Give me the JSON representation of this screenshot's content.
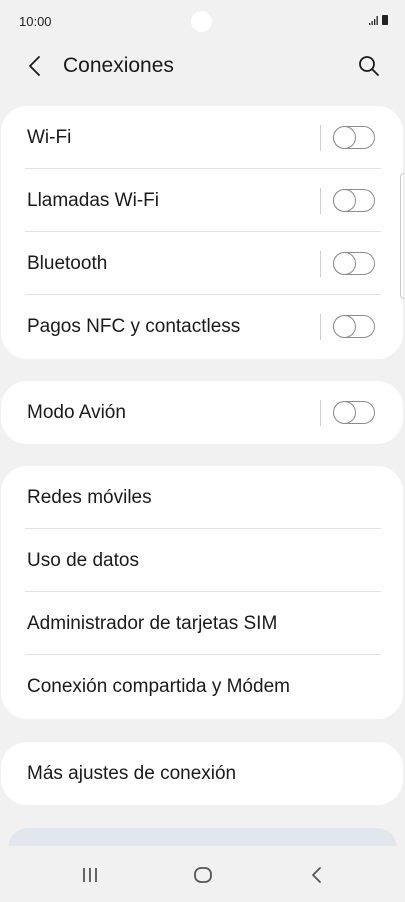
{
  "status_bar": {
    "time": "10:00",
    "icons": [
      "signal-icon",
      "battery-icon"
    ]
  },
  "header": {
    "title": "Conexiones",
    "back_icon": "chevron-left-icon",
    "search_icon": "search-icon"
  },
  "groups": {
    "wireless": [
      {
        "label": "Wi-Fi",
        "toggle": false
      },
      {
        "label": "Llamadas Wi-Fi",
        "toggle": false
      },
      {
        "label": "Bluetooth",
        "toggle": false
      },
      {
        "label": "Pagos NFC y contactless",
        "toggle": false
      }
    ],
    "airplane": [
      {
        "label": "Modo Avión",
        "toggle": false
      }
    ],
    "networks": [
      {
        "label": "Redes móviles"
      },
      {
        "label": "Uso de datos"
      },
      {
        "label": "Administrador de tarjetas SIM"
      },
      {
        "label": "Conexión compartida y Módem"
      }
    ],
    "more": [
      {
        "label": "Más ajustes de conexión"
      }
    ]
  },
  "nav_bar": {
    "icons": [
      "recent-apps-icon",
      "home-icon",
      "back-icon"
    ]
  },
  "colors": {
    "background": "#f1f1f1",
    "card": "#ffffff",
    "toggle_outline": "#8c8c8c"
  }
}
